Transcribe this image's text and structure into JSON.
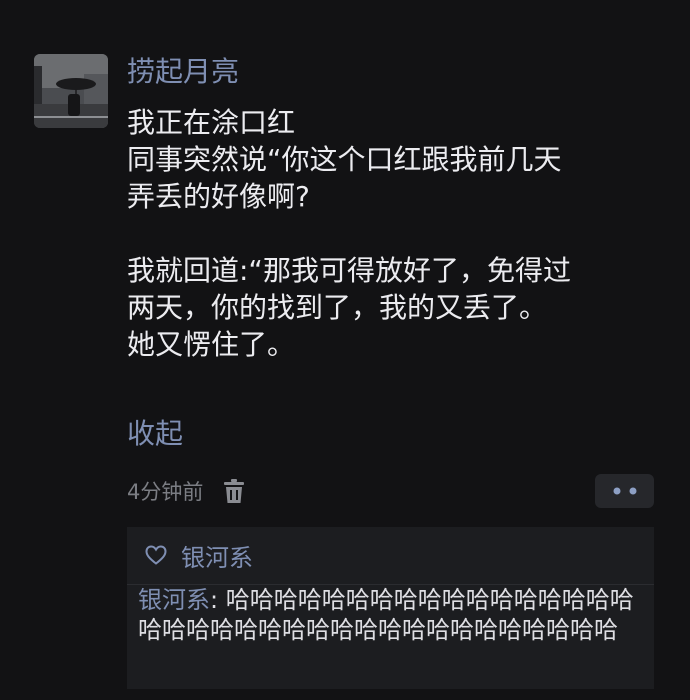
{
  "post": {
    "username": "捞起月亮",
    "body_lines": [
      "我正在涂口红",
      "同事突然说“你这个口红跟我前几天",
      "弄丢的好像啊?",
      "",
      "我就回道:“那我可得放好了，免得过",
      "两天，你的找到了，我的又丢了。",
      "她又愣住了。"
    ],
    "collapse_label": "收起",
    "time": "4分钟前"
  },
  "likes": {
    "names": "银河系"
  },
  "comment": {
    "author": "银河系",
    "separator": ": ",
    "text": "哈哈哈哈哈哈哈哈哈哈哈哈哈哈哈哈哈哈哈哈哈哈哈哈哈哈哈哈哈哈哈哈哈哈哈哈哈"
  },
  "colors": {
    "background": "#121214",
    "link": "#7f8fb3",
    "text": "#ececf0",
    "muted": "#7b7d83",
    "comment_bg": "#1c1d20"
  },
  "icons": {
    "delete": "trash-icon",
    "more": "more-dots-icon",
    "like": "heart-icon"
  }
}
